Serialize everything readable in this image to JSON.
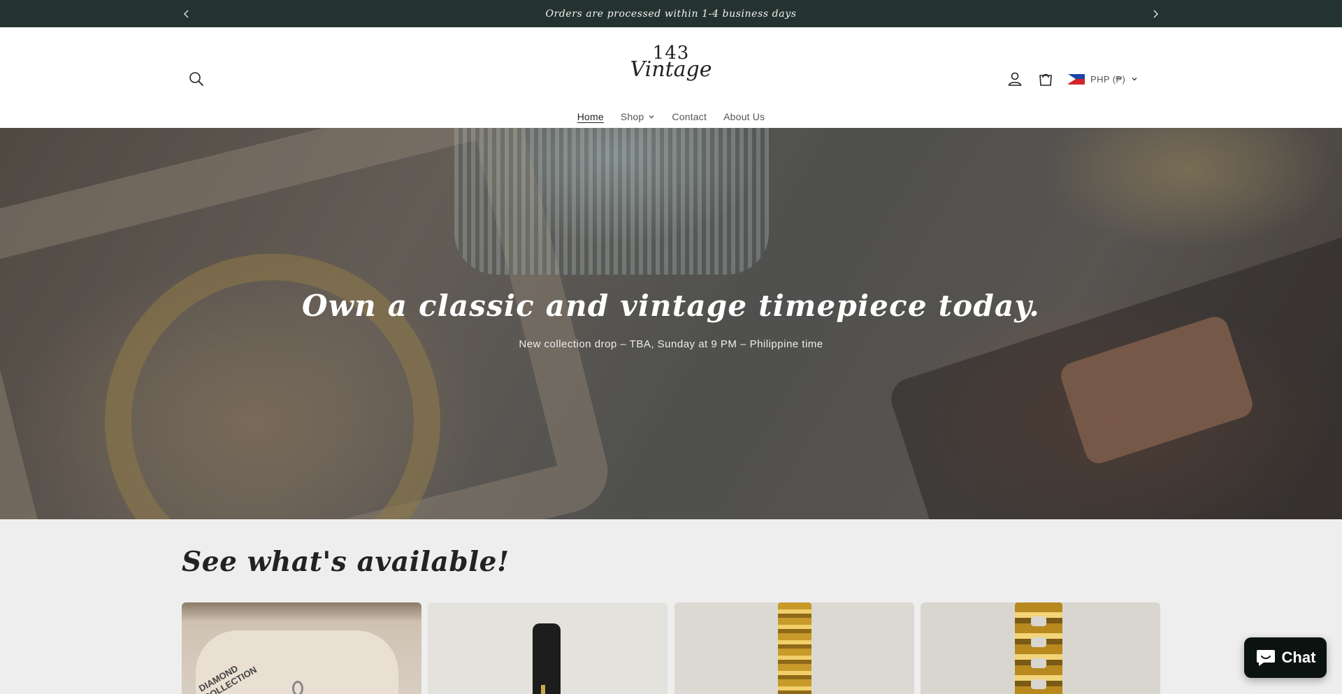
{
  "announcement": {
    "text": "Orders are processed within 1-4 business days",
    "prev_icon": "chevron-left-icon",
    "next_icon": "chevron-right-icon"
  },
  "header": {
    "logo": {
      "number": "143",
      "word": "Vintage"
    },
    "icons": [
      "search-icon",
      "account-icon",
      "cart-icon"
    ],
    "currency": {
      "label": "PHP (₱)",
      "flag": "philippines-flag"
    }
  },
  "nav": {
    "items": [
      {
        "label": "Home",
        "active": true
      },
      {
        "label": "Shop",
        "has_dropdown": true
      },
      {
        "label": "Contact"
      },
      {
        "label": "About Us"
      }
    ]
  },
  "hero": {
    "title": "Own a classic and vintage timepiece today.",
    "subtitle": "New collection drop – TBA, Sunday at 9 PM – Philippine time"
  },
  "collection": {
    "title": "See what's available!",
    "card_label_text": "DIAMOND COLLECTION"
  },
  "chat": {
    "label": "Chat",
    "icon": "chat-bubble-icon"
  },
  "colors": {
    "announcement_bg": "#243330",
    "chat_bg": "#0b1310",
    "section_bg": "#efeeee"
  }
}
